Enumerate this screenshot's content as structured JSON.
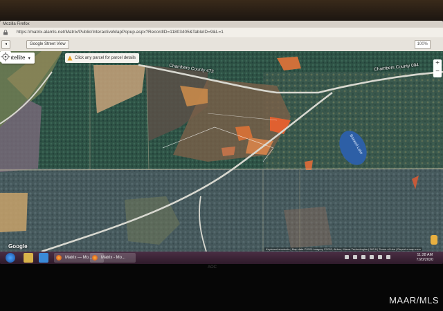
{
  "window_title": "Mozilla Firefox",
  "address_bar": {
    "url": "https://matrix.alamls.net/Matrix/Public/InteractiveMapPopup.aspx?RecordID=11803405&TableID=9&L=1"
  },
  "toolbar": {
    "street_view_label": "Google Street View",
    "zoom_level": "100%"
  },
  "map": {
    "map_type_label": "Satellite",
    "hint_text": "Click any parcel for parcel details",
    "zoom_in": "+",
    "zoom_out": "−",
    "road_labels": [
      "Chambers County 473",
      "Chambers County 094"
    ],
    "lake_label": "Boxwell Lake",
    "google_logo": "Google",
    "attribution": "Keyboard shortcuts | Map data ©2020 Imagery ©2020, Airbus, Maxar Technologies | 500 ft | Terms of Use | Report a map error"
  },
  "taskbar": {
    "buttons": [
      "Matrix — Mo...",
      "Matrix - Mo..."
    ],
    "time": "11:28 AM",
    "date": "7/20/2020"
  },
  "monitor_brand": "AOC",
  "watermark": "MAAR/MLS",
  "colors": {
    "forest": "#2a4a3e",
    "field": "#c79a6e",
    "road": "#d8d8d0",
    "lake": "#2d5fa6",
    "taskbar": "#4b2e44"
  }
}
